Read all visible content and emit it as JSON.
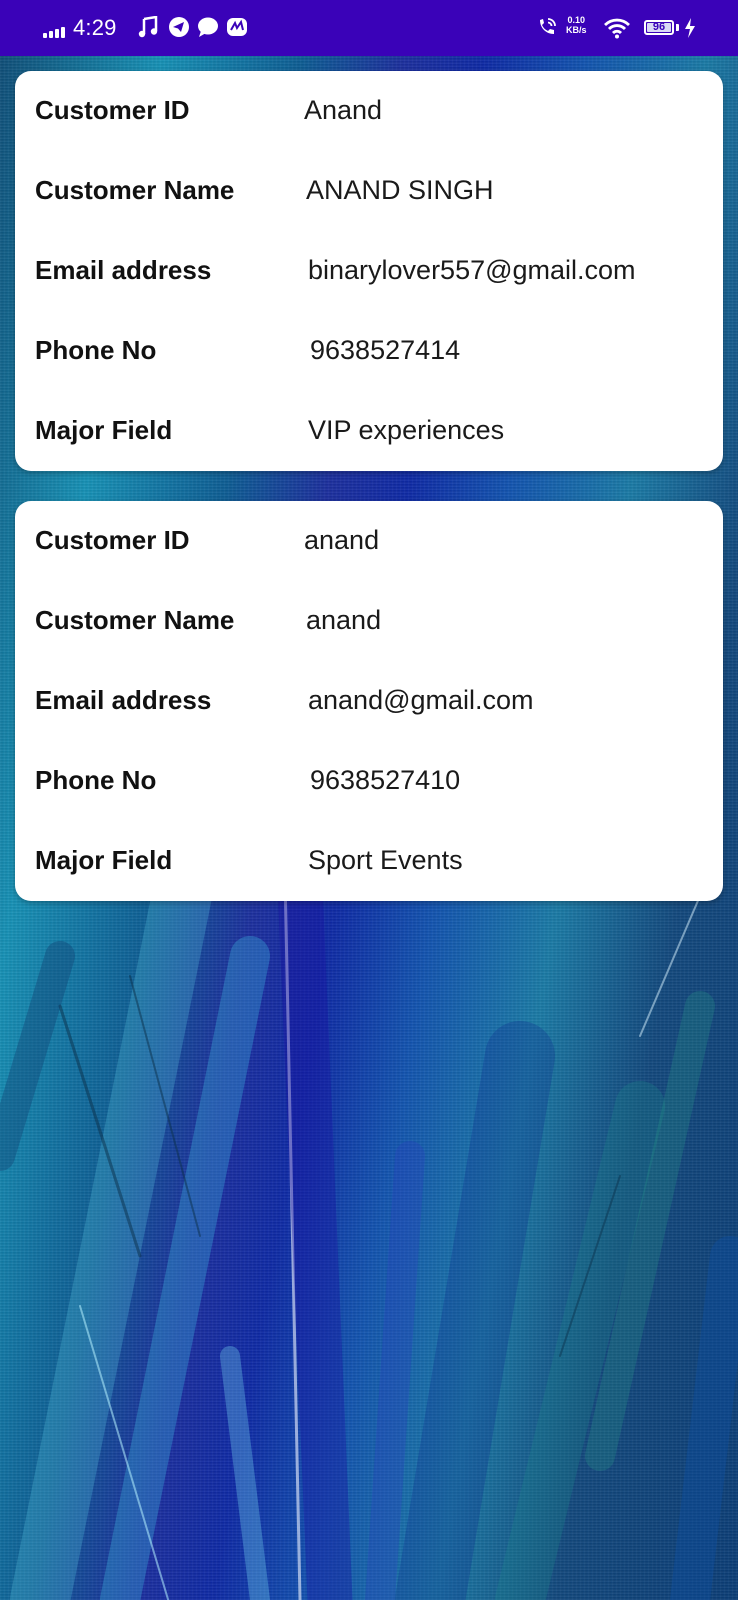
{
  "status_bar": {
    "time": "4:29",
    "net_speed_value": "0.10",
    "net_speed_unit": "KB/s",
    "battery_level": "96",
    "background_color": "#3a02b8",
    "icons": [
      "signal-icon",
      "music-note-icon",
      "telegram-icon",
      "chat-bubble-icon",
      "app-notification-icon",
      "wifi-calling-icon",
      "wifi-icon",
      "battery-icon",
      "charging-bolt-icon"
    ]
  },
  "customers": [
    {
      "id_label": "Customer ID",
      "id_value": "Anand",
      "name_label": "Customer Name",
      "name_value": "ANAND SINGH",
      "email_label": "Email address",
      "email_value": "binarylover557@gmail.com",
      "phone_label": "Phone No",
      "phone_value": "9638527414",
      "field_label": "Major Field",
      "field_value": "VIP experiences"
    },
    {
      "id_label": "Customer ID",
      "id_value": "anand",
      "name_label": "Customer Name",
      "name_value": "anand",
      "email_label": "Email address",
      "email_value": "anand@gmail.com",
      "phone_label": "Phone No",
      "phone_value": "9638527410",
      "field_label": "Major Field",
      "field_value": "Sport Events"
    }
  ]
}
